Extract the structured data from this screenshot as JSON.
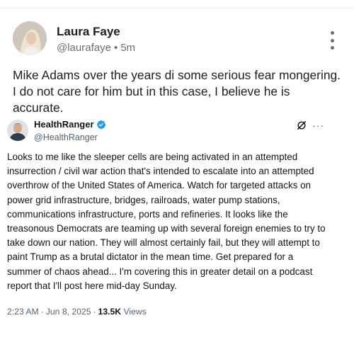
{
  "post": {
    "author_name": "Laura Faye",
    "handle": "@laurafaye",
    "separator": "•",
    "time": "5m",
    "body": "Mike Adams over the years di some serious fear mongering. I do not care for him but in this case, I believe he is accurate."
  },
  "embed": {
    "author_name": "HealthRanger",
    "handle": "@HealthRanger",
    "more_glyph": "···",
    "text": "Looks to me like the sleeper cells are being activated in an attempted insurrection / civil war action that's intended to escalate into an attempted overthrow of the United States of America. Watch for targeted attacks on power grid infrastructure, bridges, railroads, water pump stations, communications infrastructure, ports and refineries. It looks like the treasonous Democrats are teaming up with several foreign enemies to try to take down our nation. They will almost certainly fail, but they will attempt to paint Trump as a brutal dictator in the mean time. Get prepared for a summer of chaos ahead... I'm covering this in greater detail on a podcast report that I'll post here mid-day Sunday.",
    "time": "2:23 AM",
    "date": "Jun 8, 2025",
    "separator": "·",
    "views_count": "13.5K",
    "views_label": "Views"
  },
  "icons": {
    "post_menu": "kebab-vertical-icon",
    "verified": "verified-badge-icon",
    "grok": "grok-icon",
    "embed_menu": "more-horizontal-icon"
  },
  "colors": {
    "verified_blue": "#1d9bf0",
    "text_primary": "#0f1419",
    "text_secondary": "#536471"
  }
}
